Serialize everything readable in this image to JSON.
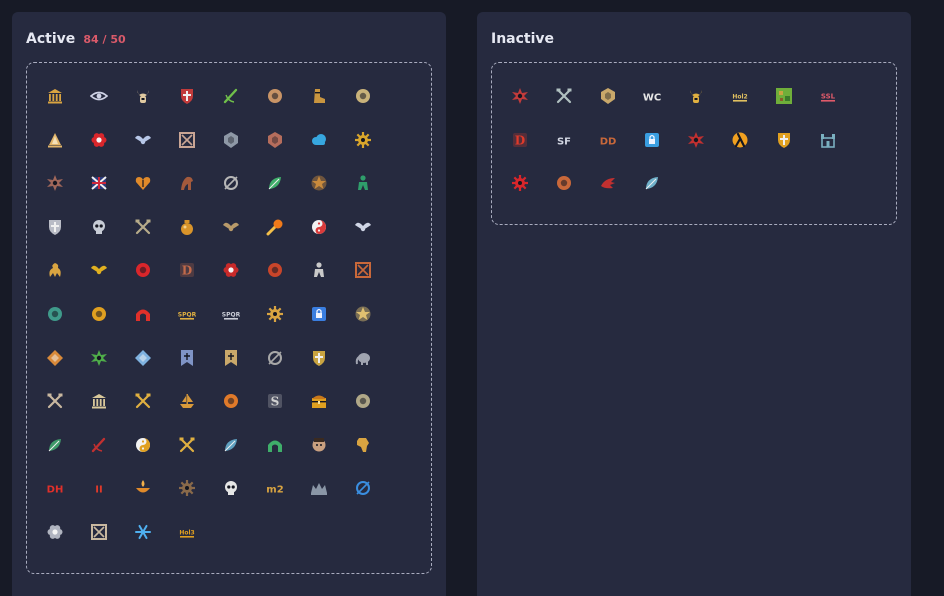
{
  "active": {
    "title": "Active",
    "count": "84 / 50",
    "icons": [
      {
        "name": "pantheon-icon",
        "shape": "temple",
        "color": "#d9a441",
        "text": ""
      },
      {
        "name": "eye-icon",
        "shape": "eye",
        "color": "#cfd3e6",
        "text": ""
      },
      {
        "name": "horned-helm-icon",
        "shape": "horns",
        "color": "#e0c9a0",
        "text": ""
      },
      {
        "name": "red-cross-shield-icon",
        "shape": "shield",
        "color": "#c23b3b",
        "text": ""
      },
      {
        "name": "green-sword-icon",
        "shape": "slash",
        "color": "#6fbf4a",
        "text": ""
      },
      {
        "name": "fist-icon",
        "shape": "disc",
        "color": "#c99466",
        "text": ""
      },
      {
        "name": "boot-icon",
        "shape": "boot",
        "color": "#c9953f",
        "text": ""
      },
      {
        "name": "compass-disc-icon",
        "shape": "disc",
        "color": "#c9b27a",
        "text": ""
      },
      {
        "name": "sail-icon",
        "shape": "sail",
        "color": "#e2b56a",
        "text": ""
      },
      {
        "name": "red-flower-icon",
        "shape": "flower",
        "color": "#d9262b",
        "text": ""
      },
      {
        "name": "bird-wings-icon",
        "shape": "wings",
        "color": "#b7c7e8",
        "text": ""
      },
      {
        "name": "checker-frame-icon",
        "shape": "frame",
        "color": "#c9a594",
        "text": ""
      },
      {
        "name": "gray-shield-icon",
        "shape": "badge",
        "color": "#8e98a6",
        "text": ""
      },
      {
        "name": "red-crest-icon",
        "shape": "badge",
        "color": "#b56d5c",
        "text": ""
      },
      {
        "name": "blue-cloud-icon",
        "shape": "cloud",
        "color": "#37a7e0",
        "text": ""
      },
      {
        "name": "gold-gear-icon",
        "shape": "gear",
        "color": "#d9a62b",
        "text": ""
      },
      {
        "name": "chaos-star-icon",
        "shape": "starburst",
        "color": "#a0675a",
        "text": ""
      },
      {
        "name": "union-flag-icon",
        "shape": "flag",
        "color": "#6f86c9",
        "text": ""
      },
      {
        "name": "orange-heart-icon",
        "shape": "heart",
        "color": "#e08a2a",
        "text": ""
      },
      {
        "name": "dark-horse-icon",
        "shape": "horse",
        "color": "#a35a3c",
        "text": ""
      },
      {
        "name": "ring-sword-icon",
        "shape": "ring",
        "color": "#b7b7b7",
        "text": ""
      },
      {
        "name": "green-feather-icon",
        "shape": "leaf",
        "color": "#3fae6a",
        "text": ""
      },
      {
        "name": "star-medal-icon",
        "shape": "star",
        "color": "#c98a3c",
        "text": ""
      },
      {
        "name": "green-figure-icon",
        "shape": "figure",
        "color": "#2f9e6b",
        "text": ""
      },
      {
        "name": "chevron-shield-icon",
        "shape": "shield",
        "color": "#b9bcc6",
        "text": ""
      },
      {
        "name": "skull-helmet-icon",
        "shape": "skull",
        "color": "#c7ccd6",
        "text": ""
      },
      {
        "name": "crossed-axes-icon",
        "shape": "cross",
        "color": "#b7ac8a",
        "text": ""
      },
      {
        "name": "gold-pot-icon",
        "shape": "pot",
        "color": "#d9942a",
        "text": ""
      },
      {
        "name": "bat-sword-icon",
        "shape": "wings",
        "color": "#b89a6a",
        "text": ""
      },
      {
        "name": "fireball-icon",
        "shape": "comet",
        "color": "#f07a1a",
        "text": ""
      },
      {
        "name": "yin-sword-icon",
        "shape": "yinyang",
        "color": "#d93a3a",
        "text": ""
      },
      {
        "name": "winged-helm-icon",
        "shape": "wings",
        "color": "#d0d6e6",
        "text": ""
      },
      {
        "name": "dragon-icon",
        "shape": "dragon",
        "color": "#d9a441",
        "text": ""
      },
      {
        "name": "gold-bee-icon",
        "shape": "wings",
        "color": "#e0b020",
        "text": ""
      },
      {
        "name": "red-black-circle-icon",
        "shape": "disc",
        "color": "#d9262b",
        "text": ""
      },
      {
        "name": "d-rune-icon",
        "shape": "rune",
        "color": "#c26a4a",
        "text": "D"
      },
      {
        "name": "red-rose-icon",
        "shape": "flower",
        "color": "#c82a2a",
        "text": ""
      },
      {
        "name": "demon-face-icon",
        "shape": "disc",
        "color": "#c8452a",
        "text": ""
      },
      {
        "name": "knight-sword-icon",
        "shape": "figure",
        "color": "#c9c9c9",
        "text": ""
      },
      {
        "name": "red-banner-icon",
        "shape": "frame",
        "color": "#c9683a",
        "text": ""
      },
      {
        "name": "teal-orb-icon",
        "shape": "disc",
        "color": "#3f9a8a",
        "text": ""
      },
      {
        "name": "flame-rune-icon",
        "shape": "disc",
        "color": "#e0a020",
        "text": ""
      },
      {
        "name": "red-arch-icon",
        "shape": "arch",
        "color": "#e0302a",
        "text": ""
      },
      {
        "name": "spqr-eagle-icon",
        "shape": "text",
        "color": "#e0b040",
        "text": "SPQR"
      },
      {
        "name": "spqr-silver-icon",
        "shape": "text",
        "color": "#c9ccd6",
        "text": "SPQR"
      },
      {
        "name": "sun-compass-icon",
        "shape": "gear",
        "color": "#d9a441",
        "text": ""
      },
      {
        "name": "blue-lock-icon",
        "shape": "lock",
        "color": "#3a7ee0",
        "text": ""
      },
      {
        "name": "star-runner-icon",
        "shape": "star",
        "color": "#e0c070",
        "text": ""
      },
      {
        "name": "orange-diamond-icon",
        "shape": "diamond",
        "color": "#d98a3a",
        "text": ""
      },
      {
        "name": "green-leaf-star-icon",
        "shape": "starburst",
        "color": "#4fae4a",
        "text": ""
      },
      {
        "name": "blue-crystal-icon",
        "shape": "diamond",
        "color": "#7fb2e0",
        "text": ""
      },
      {
        "name": "blue-banner-icon",
        "shape": "banner",
        "color": "#7f94c6",
        "text": ""
      },
      {
        "name": "gold-banner-icon",
        "shape": "banner",
        "color": "#c9a86a",
        "text": ""
      },
      {
        "name": "spiral-icon",
        "shape": "ring",
        "color": "#a8a8a8",
        "text": ""
      },
      {
        "name": "wreath-shield-icon",
        "shape": "shield",
        "color": "#c9a441",
        "text": ""
      },
      {
        "name": "elephant-icon",
        "shape": "elephant",
        "color": "#a0a4b0",
        "text": ""
      },
      {
        "name": "crossed-hammers-icon",
        "shape": "cross",
        "color": "#c9b8a0",
        "text": ""
      },
      {
        "name": "bank-icon",
        "shape": "temple",
        "color": "#d9c89a",
        "text": ""
      },
      {
        "name": "cross-pick-icon",
        "shape": "cross",
        "color": "#e0b040",
        "text": ""
      },
      {
        "name": "ship-icon",
        "shape": "ship",
        "color": "#d99a3a",
        "text": ""
      },
      {
        "name": "orange-helmet-icon",
        "shape": "disc",
        "color": "#e07a2a",
        "text": ""
      },
      {
        "name": "s-rune-icon",
        "shape": "rune",
        "color": "#d0d0d0",
        "text": "S"
      },
      {
        "name": "treasure-chest-icon",
        "shape": "chest",
        "color": "#e0a020",
        "text": ""
      },
      {
        "name": "moon-icon",
        "shape": "disc",
        "color": "#b0a888",
        "text": ""
      },
      {
        "name": "green-dragon-icon",
        "shape": "leaf",
        "color": "#3f9a6a",
        "text": ""
      },
      {
        "name": "red-scythe-icon",
        "shape": "slash",
        "color": "#c23030",
        "text": ""
      },
      {
        "name": "yin-yang-icon",
        "shape": "yinyang",
        "color": "#e0a020",
        "text": ""
      },
      {
        "name": "cross-swords-icon",
        "shape": "cross",
        "color": "#e0b040",
        "text": ""
      },
      {
        "name": "blue-green-feather-icon",
        "shape": "leaf",
        "color": "#5fa0c0",
        "text": ""
      },
      {
        "name": "green-arch-icon",
        "shape": "arch",
        "color": "#3fae6a",
        "text": ""
      },
      {
        "name": "mask-face-icon",
        "shape": "face",
        "color": "#c9a080",
        "text": ""
      },
      {
        "name": "africa-map-icon",
        "shape": "map",
        "color": "#d9a441",
        "text": ""
      },
      {
        "name": "dh-logo-icon",
        "shape": "text",
        "color": "#e0302a",
        "text": "DH"
      },
      {
        "name": "diablo-ii-icon",
        "shape": "text",
        "color": "#e03a2a",
        "text": "II"
      },
      {
        "name": "flame-bowl-icon",
        "shape": "bowl",
        "color": "#e08a2a",
        "text": ""
      },
      {
        "name": "bronze-compass-icon",
        "shape": "gear",
        "color": "#8a6a4a",
        "text": ""
      },
      {
        "name": "skull-crossbones-icon",
        "shape": "skull",
        "color": "#e6e6e6",
        "text": ""
      },
      {
        "name": "m2-logo-icon",
        "shape": "text",
        "color": "#d9a441",
        "text": "m2"
      },
      {
        "name": "dark-crown-icon",
        "shape": "crown",
        "color": "#8a96a6",
        "text": ""
      },
      {
        "name": "blue-ring-sword-icon",
        "shape": "ring",
        "color": "#3a8ee0",
        "text": ""
      },
      {
        "name": "silver-lotus-icon",
        "shape": "flower",
        "color": "#b0b4c0",
        "text": ""
      },
      {
        "name": "dual-frame-icon",
        "shape": "frame",
        "color": "#c9b8a0",
        "text": ""
      },
      {
        "name": "snowflake-icon",
        "shape": "snow",
        "color": "#4fb0f0",
        "text": ""
      },
      {
        "name": "hol3-logo-icon",
        "shape": "text",
        "color": "#e0a020",
        "text": "Hol3"
      }
    ]
  },
  "inactive": {
    "title": "Inactive",
    "icons": [
      {
        "name": "chaos-wheel-icon",
        "shape": "starburst",
        "color": "#c23b3b",
        "text": ""
      },
      {
        "name": "crossed-blades-icon",
        "shape": "cross",
        "color": "#b0c0c0",
        "text": ""
      },
      {
        "name": "gold-crest-icon",
        "shape": "badge",
        "color": "#c9a86a",
        "text": ""
      },
      {
        "name": "wc-logo-icon",
        "shape": "text",
        "color": "#e6e6e6",
        "text": "WC"
      },
      {
        "name": "gold-helm-icon",
        "shape": "horns",
        "color": "#e0b040",
        "text": ""
      },
      {
        "name": "hol2-logo-icon",
        "shape": "text",
        "color": "#e0c060",
        "text": "Hol2"
      },
      {
        "name": "pixel-map-icon",
        "shape": "tile",
        "color": "#6fae3a",
        "text": ""
      },
      {
        "name": "ssl-flag-icon",
        "shape": "text",
        "color": "#e05a6a",
        "text": "SSL"
      },
      {
        "name": "red-d-icon",
        "shape": "rune",
        "color": "#e03a2a",
        "text": "D"
      },
      {
        "name": "sf-logo-icon",
        "shape": "text",
        "color": "#d0d4e0",
        "text": "SF"
      },
      {
        "name": "dd-logo-icon",
        "shape": "text",
        "color": "#c9683a",
        "text": "DD"
      },
      {
        "name": "blue-robot-icon",
        "shape": "lock",
        "color": "#3a9ee0",
        "text": ""
      },
      {
        "name": "red-beast-icon",
        "shape": "starburst",
        "color": "#c23030",
        "text": ""
      },
      {
        "name": "half-life-icon",
        "shape": "lambda",
        "color": "#f0a020",
        "text": ""
      },
      {
        "name": "flame-shield-icon",
        "shape": "shield",
        "color": "#e0a020",
        "text": ""
      },
      {
        "name": "teal-castle-icon",
        "shape": "castle",
        "color": "#7ab0c0",
        "text": ""
      },
      {
        "name": "red-cog-icon",
        "shape": "gear",
        "color": "#d9262b",
        "text": ""
      },
      {
        "name": "swirl-disc-icon",
        "shape": "disc",
        "color": "#c9683a",
        "text": ""
      },
      {
        "name": "dragon-claw-icon",
        "shape": "claw",
        "color": "#c23030",
        "text": ""
      },
      {
        "name": "blue-feather-icon",
        "shape": "leaf",
        "color": "#6fb0c9",
        "text": ""
      }
    ]
  }
}
